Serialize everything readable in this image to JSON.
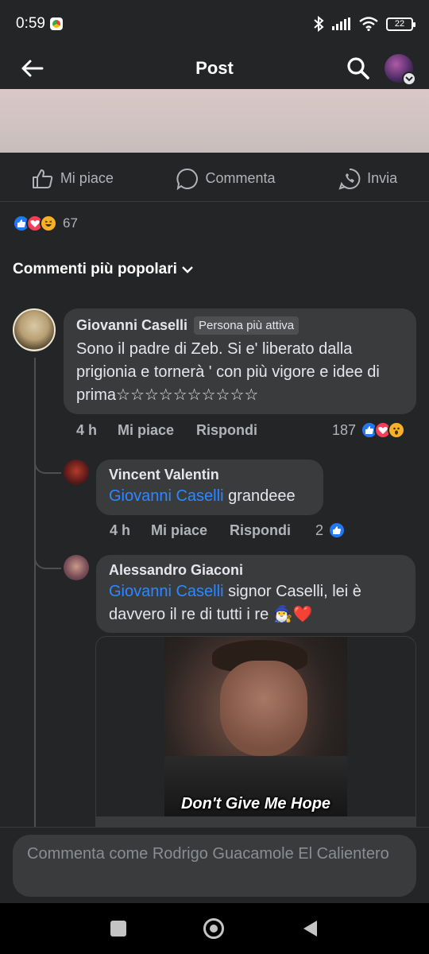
{
  "status_bar": {
    "time": "0:59",
    "battery": "22"
  },
  "app_bar": {
    "title": "Post"
  },
  "post_actions": {
    "like": "Mi piace",
    "comment": "Commenta",
    "share": "Invia"
  },
  "post_reactions": {
    "count": "67",
    "types": [
      "like",
      "love",
      "haha"
    ]
  },
  "comments_sort": {
    "label": "Commenti più popolari"
  },
  "comments": [
    {
      "author": "Giovanni Caselli",
      "badge": "Persona più attiva",
      "text": "Sono il padre di Zeb. Si e' liberato dalla prigionia e tornerà ' con più vigore e idee di prima☆☆☆☆☆☆☆☆☆☆",
      "time": "4 h",
      "like_label": "Mi piace",
      "reply_label": "Rispondi",
      "reaction_count": "187",
      "reaction_types": [
        "like",
        "love",
        "wow"
      ]
    },
    {
      "author": "Vincent Valentin",
      "mention": "Giovanni Caselli",
      "text": "grandeee",
      "time": "4 h",
      "like_label": "Mi piace",
      "reply_label": "Rispondi",
      "reaction_count": "2",
      "reaction_types": [
        "like"
      ]
    },
    {
      "author": "Alessandro Giaconi",
      "mention": "Giovanni Caselli",
      "text": "signor Caselli, lei è davvero il re di tutti i re",
      "emoji": "🧙‍♂️❤️",
      "gif_caption": "Don't Give Me Hope"
    }
  ],
  "composer": {
    "placeholder": "Commenta come Rodrigo Guacamole El Calientero"
  }
}
